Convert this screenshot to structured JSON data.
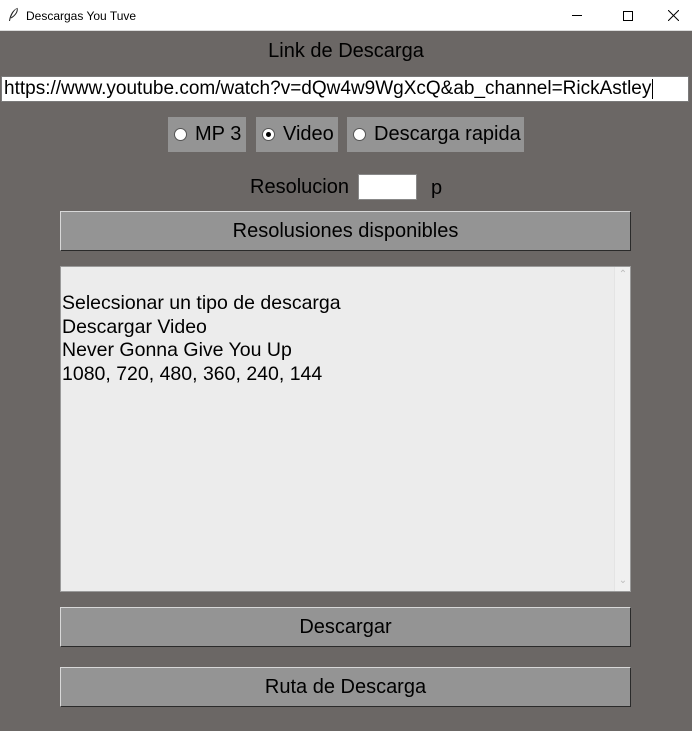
{
  "window": {
    "title": "Descargas You Tuve",
    "app_icon": "feather-icon",
    "controls": [
      "minimize-icon",
      "maximize-icon",
      "close-icon"
    ]
  },
  "link": {
    "label": "Link de Descarga",
    "url": "https://www.youtube.com/watch?v=dQw4w9WgXcQ&ab_channel=RickAstley"
  },
  "download_type": {
    "options": [
      {
        "label": "MP 3",
        "checked": false
      },
      {
        "label": "Video",
        "checked": true
      },
      {
        "label": "Descarga rapida",
        "checked": false
      }
    ]
  },
  "resolution": {
    "label": "Resolucion",
    "value": "",
    "unit": "p"
  },
  "buttons": {
    "resoluciones": "Resolusiones disponibles",
    "descargar": "Descargar",
    "ruta": "Ruta de Descarga"
  },
  "output": {
    "lines": [
      "Selecsionar un tipo de descarga",
      "Descargar Video",
      "Never Gonna Give You Up",
      "1080, 720, 480, 360, 240, 144"
    ]
  },
  "colors": {
    "background": "#6b6765",
    "button": "#949494",
    "text_area": "#ececec"
  }
}
